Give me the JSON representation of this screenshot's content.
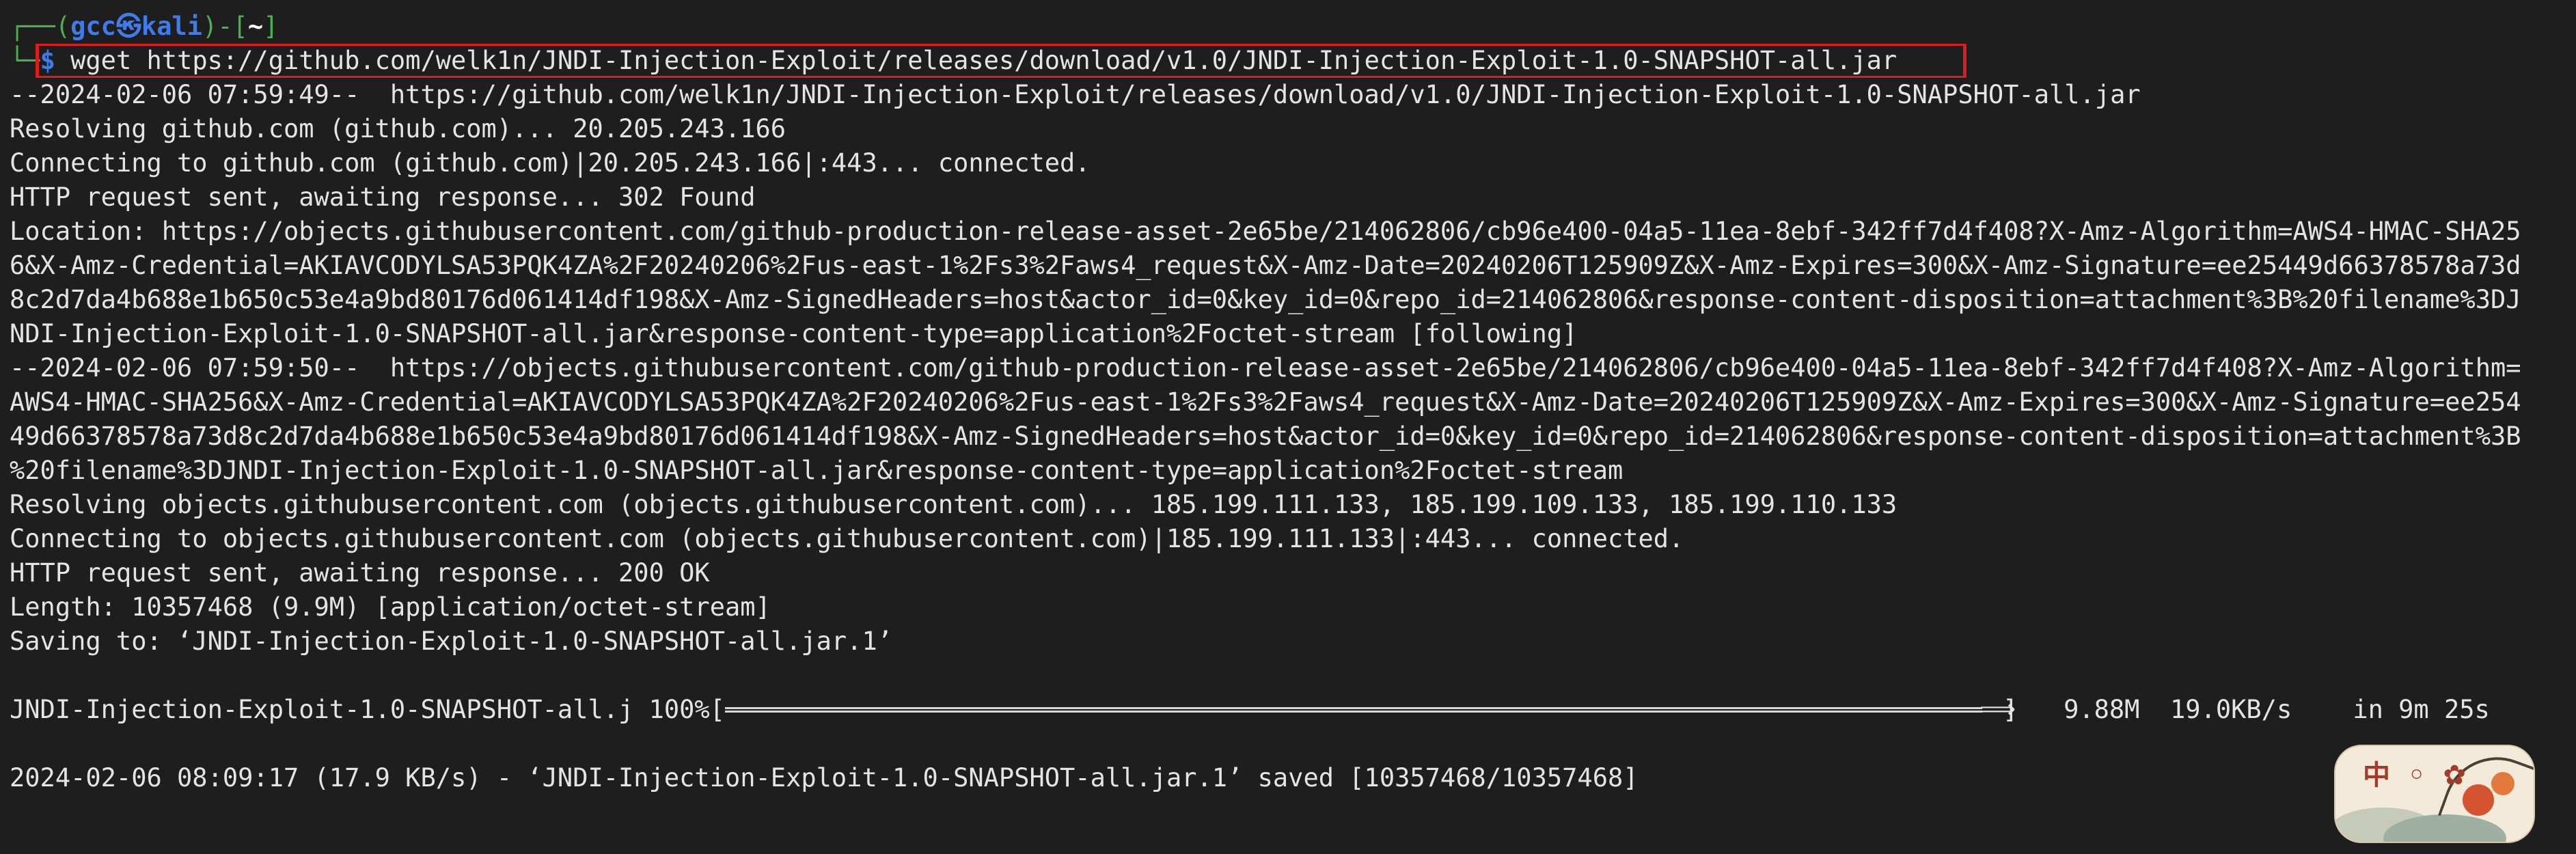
{
  "prompt": {
    "frame_left": "┌──(",
    "user_host": "gcc㉿kali",
    "frame_mid": ")-[",
    "path": "~",
    "frame_right": "]",
    "frame_bottom": "└─",
    "dollar": "$",
    "command": " wget https://github.com/welk1n/JNDI-Injection-Exploit/releases/download/v1.0/JNDI-Injection-Exploit-1.0-SNAPSHOT-all.jar"
  },
  "output_lines": [
    "--2024-02-06 07:59:49--  https://github.com/welk1n/JNDI-Injection-Exploit/releases/download/v1.0/JNDI-Injection-Exploit-1.0-SNAPSHOT-all.jar",
    "Resolving github.com (github.com)... 20.205.243.166",
    "Connecting to github.com (github.com)|20.205.243.166|:443... connected.",
    "HTTP request sent, awaiting response... 302 Found",
    "Location: https://objects.githubusercontent.com/github-production-release-asset-2e65be/214062806/cb96e400-04a5-11ea-8ebf-342ff7d4f408?X-Amz-Algorithm=AWS4-HMAC-SHA25",
    "6&X-Amz-Credential=AKIAVCODYLSA53PQK4ZA%2F20240206%2Fus-east-1%2Fs3%2Faws4_request&X-Amz-Date=20240206T125909Z&X-Amz-Expires=300&X-Amz-Signature=ee25449d66378578a73d",
    "8c2d7da4b688e1b650c53e4a9bd80176d061414df198&X-Amz-SignedHeaders=host&actor_id=0&key_id=0&repo_id=214062806&response-content-disposition=attachment%3B%20filename%3DJ",
    "NDI-Injection-Exploit-1.0-SNAPSHOT-all.jar&response-content-type=application%2Foctet-stream [following]",
    "--2024-02-06 07:59:50--  https://objects.githubusercontent.com/github-production-release-asset-2e65be/214062806/cb96e400-04a5-11ea-8ebf-342ff7d4f408?X-Amz-Algorithm=",
    "AWS4-HMAC-SHA256&X-Amz-Credential=AKIAVCODYLSA53PQK4ZA%2F20240206%2Fus-east-1%2Fs3%2Faws4_request&X-Amz-Date=20240206T125909Z&X-Amz-Expires=300&X-Amz-Signature=ee254",
    "49d66378578a73d8c2d7da4b688e1b650c53e4a9bd80176d061414df198&X-Amz-SignedHeaders=host&actor_id=0&key_id=0&repo_id=214062806&response-content-disposition=attachment%3B",
    "%20filename%3DJNDI-Injection-Exploit-1.0-SNAPSHOT-all.jar&response-content-type=application%2Foctet-stream",
    "Resolving objects.githubusercontent.com (objects.githubusercontent.com)... 185.199.111.133, 185.199.109.133, 185.199.110.133",
    "Connecting to objects.githubusercontent.com (objects.githubusercontent.com)|185.199.111.133|:443... connected.",
    "HTTP request sent, awaiting response... 200 OK",
    "Length: 10357468 (9.9M) [application/octet-stream]",
    "Saving to: ‘JNDI-Injection-Exploit-1.0-SNAPSHOT-all.jar.1’"
  ],
  "progress": {
    "filename": "JNDI-Injection-Exploit-1.0-SNAPSHOT-all.j",
    "percent_label": " 100%[",
    "percent": 100,
    "bar_end": "]",
    "stats": "   9.88M  19.0KB/s    in 9m 25s"
  },
  "final_line": "2024-02-06 08:09:17 (17.9 KB/s) - ‘JNDI-Injection-Exploit-1.0-SNAPSHOT-all.jar.1’ saved [10357468/10357468]",
  "watermark": {
    "logo_text": "中 ◦ ✿"
  }
}
